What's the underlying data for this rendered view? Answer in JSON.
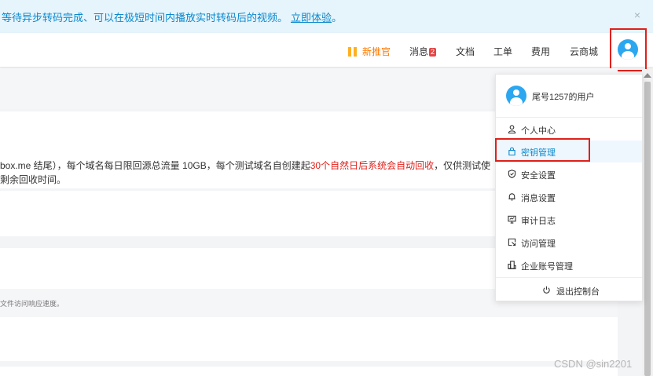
{
  "notice": {
    "text": "等待异步转码完成、可以在极短时间内播放实时转码后的视频。",
    "link": "立即体验",
    "suffix": "。",
    "close_glyph": "×"
  },
  "topnav": {
    "items": [
      {
        "label": "新推官",
        "icon": "gift-icon",
        "color": "#ff7a00"
      },
      {
        "label": "消息",
        "badge": "2"
      },
      {
        "label": "文档"
      },
      {
        "label": "工单"
      },
      {
        "label": "费用"
      },
      {
        "label": "云商城"
      }
    ]
  },
  "content": {
    "line1_prefix": "box.me 结尾），每个域名每日限回源总流量 10GB，每个测试域名自创建起",
    "line1_red": "30个自然日后系统会自动回收",
    "line1_suffix": "，仅供测试使",
    "line2": "剩余回收时间。",
    "note": "文件访问响应速度。"
  },
  "user_menu": {
    "username": "尾号1257的用户",
    "items": [
      {
        "label": "个人中心",
        "icon": "user-icon",
        "active": false
      },
      {
        "label": "密钥管理",
        "icon": "lock-icon",
        "active": true
      },
      {
        "label": "安全设置",
        "icon": "shield-icon",
        "active": false
      },
      {
        "label": "消息设置",
        "icon": "bell-icon",
        "active": false
      },
      {
        "label": "审计日志",
        "icon": "monitor-icon",
        "active": false
      },
      {
        "label": "访问管理",
        "icon": "access-icon",
        "active": false
      },
      {
        "label": "企业账号管理",
        "icon": "building-icon",
        "active": false
      }
    ],
    "logout": "退出控制台"
  },
  "watermark": "CSDN @sin2201",
  "colors": {
    "accent": "#0a89cc",
    "highlight": "#e0201a",
    "promo": "#ff7a00",
    "avatar": "#2ba7f0"
  }
}
